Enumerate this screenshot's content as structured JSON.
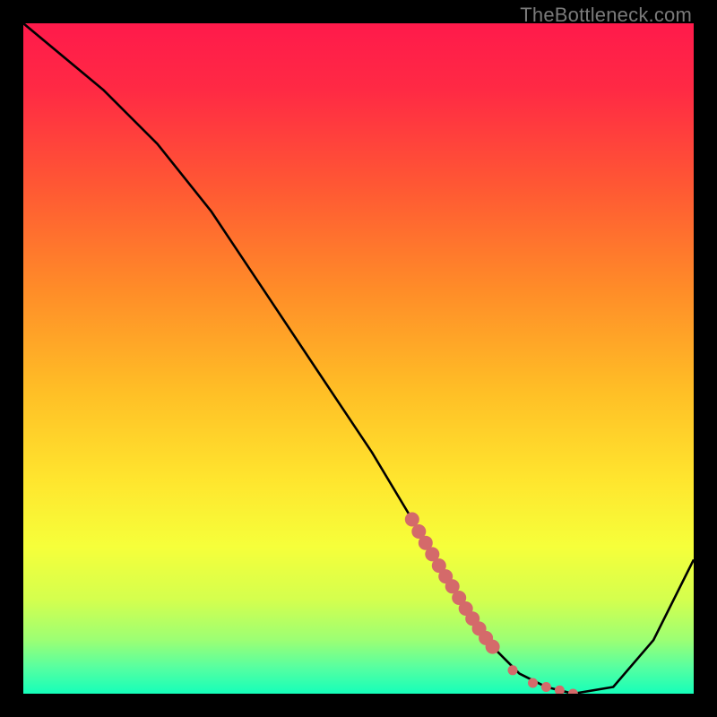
{
  "watermark": "TheBottleneck.com",
  "colors": {
    "frame": "#000000",
    "gradient_stops": [
      {
        "offset": 0.0,
        "color": "#ff1a4b"
      },
      {
        "offset": 0.1,
        "color": "#ff2a44"
      },
      {
        "offset": 0.25,
        "color": "#ff5a33"
      },
      {
        "offset": 0.4,
        "color": "#ff8d28"
      },
      {
        "offset": 0.55,
        "color": "#ffbf26"
      },
      {
        "offset": 0.68,
        "color": "#ffe52e"
      },
      {
        "offset": 0.78,
        "color": "#f6ff3a"
      },
      {
        "offset": 0.86,
        "color": "#d4ff4e"
      },
      {
        "offset": 0.92,
        "color": "#9cff74"
      },
      {
        "offset": 0.96,
        "color": "#58ffa0"
      },
      {
        "offset": 1.0,
        "color": "#15ffba"
      }
    ],
    "curve": "#000000",
    "dots": "#d46a6a"
  },
  "chart_data": {
    "type": "line",
    "title": "",
    "xlabel": "",
    "ylabel": "",
    "xlim": [
      0,
      100
    ],
    "ylim": [
      0,
      100
    ],
    "series": [
      {
        "name": "bottleneck-curve",
        "x": [
          0,
          12,
          20,
          28,
          36,
          44,
          52,
          58,
          64,
          70,
          74,
          78,
          82,
          88,
          94,
          100
        ],
        "y": [
          100,
          90,
          82,
          72,
          60,
          48,
          36,
          26,
          16,
          7,
          3,
          1,
          0,
          1,
          8,
          20
        ]
      }
    ],
    "markers": {
      "name": "highlight-dots",
      "points": [
        {
          "x": 58,
          "y": 26
        },
        {
          "x": 59,
          "y": 24.2
        },
        {
          "x": 60,
          "y": 22.5
        },
        {
          "x": 61,
          "y": 20.8
        },
        {
          "x": 62,
          "y": 19.1
        },
        {
          "x": 63,
          "y": 17.5
        },
        {
          "x": 64,
          "y": 16.0
        },
        {
          "x": 65,
          "y": 14.3
        },
        {
          "x": 66,
          "y": 12.7
        },
        {
          "x": 67,
          "y": 11.2
        },
        {
          "x": 68,
          "y": 9.7
        },
        {
          "x": 69,
          "y": 8.3
        },
        {
          "x": 70,
          "y": 7.0
        },
        {
          "x": 73,
          "y": 3.5
        },
        {
          "x": 76,
          "y": 1.6
        },
        {
          "x": 78,
          "y": 1.0
        },
        {
          "x": 80,
          "y": 0.5
        },
        {
          "x": 82,
          "y": 0.0
        }
      ]
    }
  }
}
